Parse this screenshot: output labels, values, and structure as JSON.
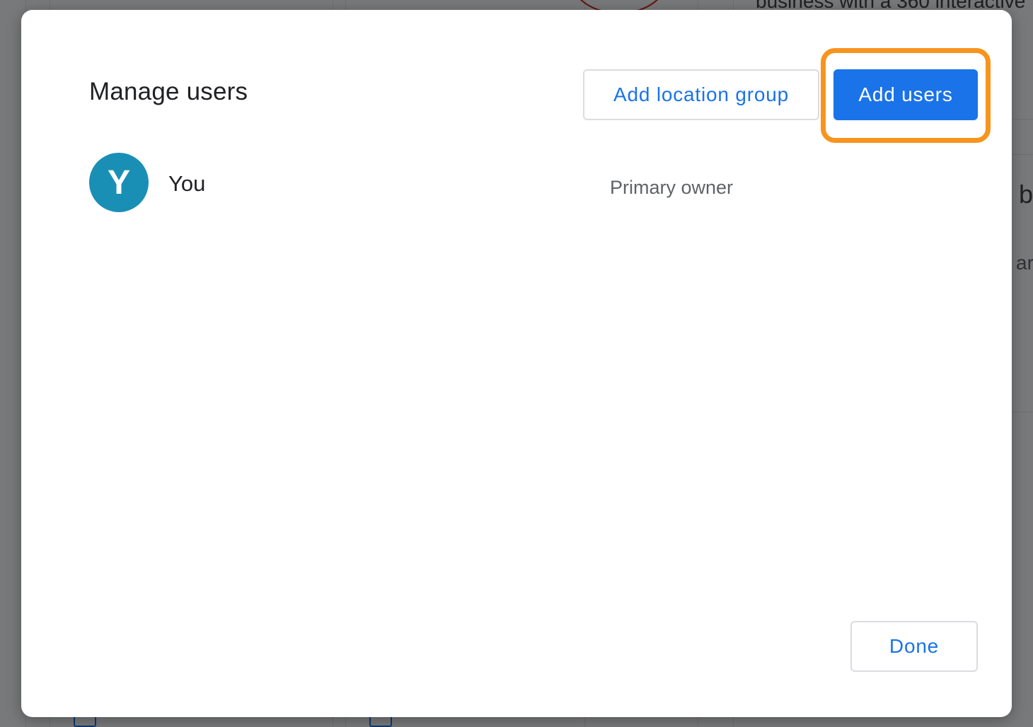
{
  "background": {
    "snippet_top": "business with a 360 interactive",
    "snippet_mid": "r b",
    "snippet_low": "ar"
  },
  "dialog": {
    "title": "Manage users",
    "add_location_group_label": "Add location group",
    "add_users_label": "Add users",
    "done_label": "Done"
  },
  "users": [
    {
      "initial": "Y",
      "name": "You",
      "role": "Primary owner",
      "avatar_color": "#1a8fb5"
    }
  ],
  "colors": {
    "accent": "#1a73e8",
    "highlight": "#f7941d"
  }
}
